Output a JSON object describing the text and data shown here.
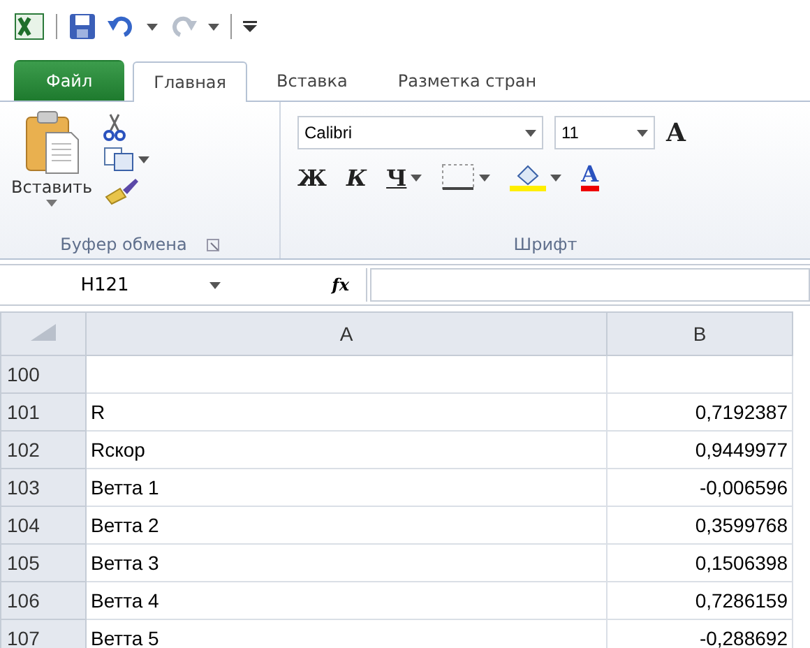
{
  "tabs": [
    {
      "label": "Файл",
      "kind": "file",
      "selected": false
    },
    {
      "label": "Главная",
      "kind": "tab",
      "selected": true
    },
    {
      "label": "Вставка",
      "kind": "tab",
      "selected": false
    },
    {
      "label": "Разметка стран",
      "kind": "tab",
      "selected": false
    }
  ],
  "clipboard": {
    "paste_label": "Вставить",
    "group_label": "Буфер обмена"
  },
  "font": {
    "name": "Calibri",
    "size": "11",
    "grow_glyph": "A",
    "bold_glyph": "Ж",
    "italic_glyph": "К",
    "underline_glyph": "Ч",
    "color_glyph": "A",
    "group_label": "Шрифт"
  },
  "formula_bar": {
    "name_box": "H121",
    "fx": "fx"
  },
  "sheet": {
    "columns": [
      "A",
      "B"
    ],
    "rows": [
      {
        "number": "100",
        "cells": [
          "",
          ""
        ]
      },
      {
        "number": "101",
        "cells": [
          "R",
          "0,7192387"
        ]
      },
      {
        "number": "102",
        "cells": [
          "Rскор",
          "0,9449977"
        ]
      },
      {
        "number": "103",
        "cells": [
          "Ветта 1",
          "-0,006596"
        ]
      },
      {
        "number": "104",
        "cells": [
          "Ветта 2",
          "0,3599768"
        ]
      },
      {
        "number": "105",
        "cells": [
          "Ветта 3",
          "0,1506398"
        ]
      },
      {
        "number": "106",
        "cells": [
          "Ветта 4",
          "0,7286159"
        ]
      },
      {
        "number": "107",
        "cells": [
          "Ветта 5",
          "-0,288692"
        ]
      }
    ]
  }
}
